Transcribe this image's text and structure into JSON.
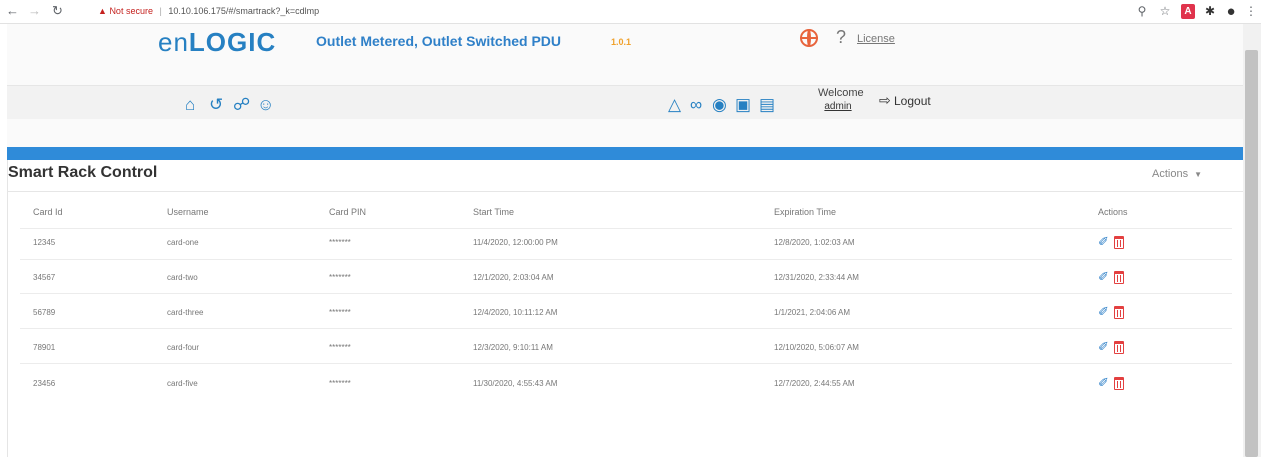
{
  "browser": {
    "not_secure": "Not secure",
    "url": "10.10.106.175/#/smartrack?_k=cdlmp"
  },
  "header": {
    "logo_en": "en",
    "logo_logic": "LOGIC",
    "product": "Outlet Metered, Outlet Switched PDU",
    "version": "1.0.1",
    "help": "?",
    "license": "License"
  },
  "toolbar": {
    "welcome": "Welcome",
    "user": "admin",
    "logout": "Logout"
  },
  "section": {
    "title": "Smart Rack Control",
    "actions": "Actions"
  },
  "table": {
    "columns": [
      "Card Id",
      "Username",
      "Card PIN",
      "Start Time",
      "Expiration Time",
      "Actions"
    ],
    "rows": [
      {
        "id": "12345",
        "username": "card-one",
        "pin": "*******",
        "start": "11/4/2020, 12:00:00 PM",
        "expire": "12/8/2020, 1:02:03 AM"
      },
      {
        "id": "34567",
        "username": "card-two",
        "pin": "*******",
        "start": "12/1/2020, 2:03:04 AM",
        "expire": "12/31/2020, 2:33:44 AM"
      },
      {
        "id": "56789",
        "username": "card-three",
        "pin": "*******",
        "start": "12/4/2020, 10:11:12 AM",
        "expire": "1/1/2021, 2:04:06 AM"
      },
      {
        "id": "78901",
        "username": "card-four",
        "pin": "*******",
        "start": "12/3/2020, 9:10:11 AM",
        "expire": "12/10/2020, 5:06:07 AM"
      },
      {
        "id": "23456",
        "username": "card-five",
        "pin": "*******",
        "start": "11/30/2020, 4:55:43 AM",
        "expire": "12/7/2020, 2:44:55 AM"
      }
    ]
  },
  "colors": {
    "brand_blue": "#2680c2",
    "band_blue": "#2f8bd9",
    "delete_red": "#e34040",
    "version_orange": "#f0a12b"
  },
  "icons": {
    "toolbar_left": [
      "home-icon",
      "history-icon",
      "globe-icon",
      "users-icon"
    ],
    "toolbar_right": [
      "alert-icon",
      "link-icon",
      "bulb-icon",
      "lock-icon",
      "calendar-icon"
    ]
  }
}
